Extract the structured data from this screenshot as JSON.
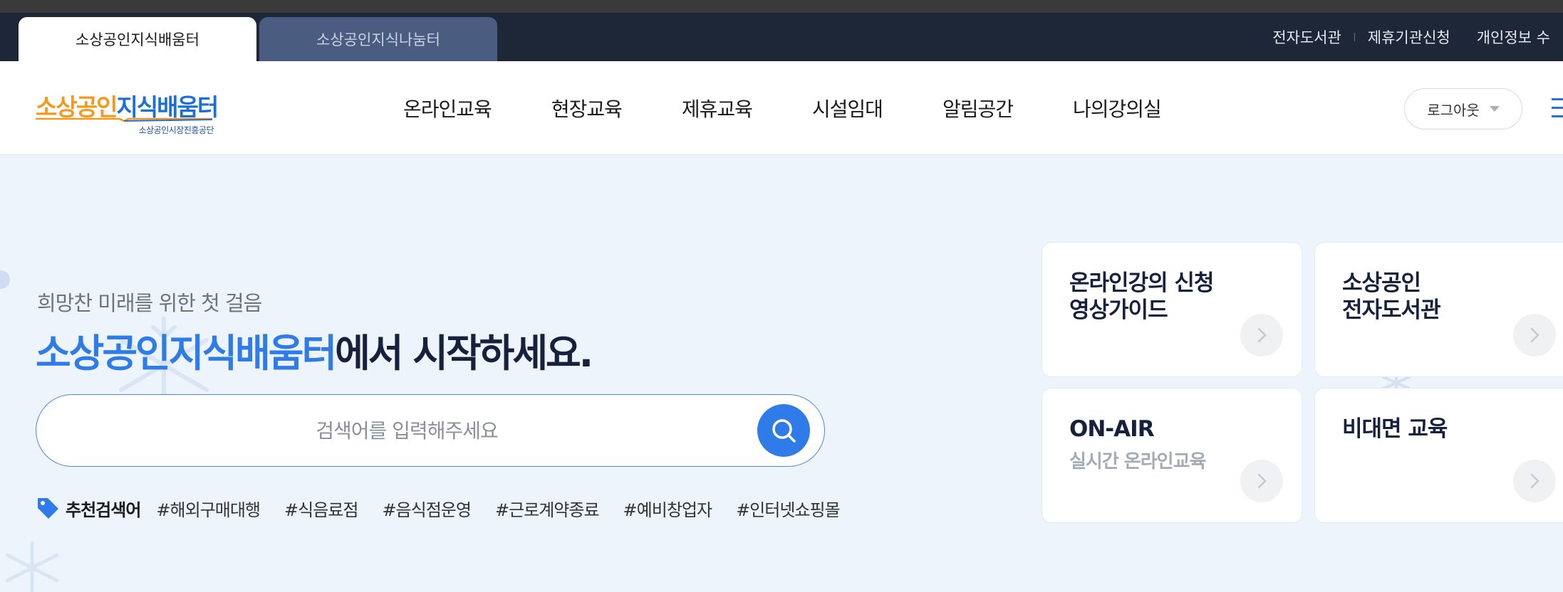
{
  "top_tabs": [
    {
      "label": "소상공인지식배움터",
      "active": true
    },
    {
      "label": "소상공인지식나눔터",
      "active": false
    }
  ],
  "util_links": [
    "전자도서관",
    "제휴기관신청",
    "개인정보 수"
  ],
  "logo": {
    "part1": "소상공인",
    "part2": "지식배움터",
    "subtext": "소상공인시장진흥공단",
    "colors": {
      "orange": "#f39a1e",
      "blue": "#1d6fd8"
    }
  },
  "nav": [
    "온라인교육",
    "현장교육",
    "제휴교육",
    "시설임대",
    "알림공간",
    "나의강의실"
  ],
  "logout_label": "로그아웃",
  "hero": {
    "subtitle": "희망찬 미래를 위한 첫 걸음",
    "headline_highlight": "소상공인지식배움터",
    "headline_rest": "에서 시작하세요."
  },
  "search": {
    "placeholder": "검색어를 입력해주세요",
    "value": ""
  },
  "recommended": {
    "label": "추천검색어",
    "keywords": [
      "#해외구매대행",
      "#식음료점",
      "#음식점운영",
      "#근로계약종료",
      "#예비창업자",
      "#인터넷쇼핑몰"
    ]
  },
  "cards": [
    {
      "title_lines": [
        "온라인강의 신청",
        "영상가이드"
      ],
      "subtitle": ""
    },
    {
      "title_lines": [
        "소상공인",
        "전자도서관"
      ],
      "subtitle": ""
    },
    {
      "title_lines": [
        "ON-AIR"
      ],
      "subtitle": "실시간 온라인교육"
    },
    {
      "title_lines": [
        "비대면 교육"
      ],
      "subtitle": ""
    }
  ],
  "icons": {
    "search": "search-icon",
    "tag": "tag-icon",
    "menu": "hamburger-menu-icon",
    "arrow": "chevron-right-icon",
    "dropdown": "caret-down-icon"
  },
  "colors": {
    "accent": "#2f7ce8",
    "topbar": "#1e2738",
    "hero_bg": "#eef4fb",
    "heading_dark": "#16213d"
  }
}
